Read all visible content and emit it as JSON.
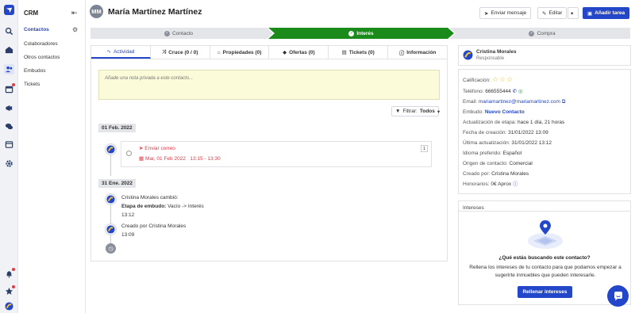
{
  "colors": {
    "brand": "#2446c9",
    "stage_done": "#e4e5e8",
    "stage_current": "#1a8a1a",
    "alert": "#e63946",
    "star": "#f2c230"
  },
  "sidebar": {
    "title": "CRM",
    "items": [
      {
        "label": "Contactos"
      },
      {
        "label": "Colaboradores"
      },
      {
        "label": "Otros contactos"
      },
      {
        "label": "Embudos"
      },
      {
        "label": "Tickets"
      }
    ]
  },
  "header": {
    "avatar_initials": "MM",
    "contact_name": "María Martínez Martínez",
    "send_message_label": "Enviar mensaje",
    "edit_label": "Editar",
    "add_task_label": "Añadir tarea"
  },
  "stages": [
    {
      "label": "Contacto"
    },
    {
      "label": "Interés"
    },
    {
      "label": "Compra"
    }
  ],
  "tabs": [
    {
      "label": "Actividad"
    },
    {
      "label": "Cruce (0 / 0)"
    },
    {
      "label": "Propiedades (0)"
    },
    {
      "label": "Ofertas (0)"
    },
    {
      "label": "Tickets (0)"
    },
    {
      "label": "Información"
    }
  ],
  "note_placeholder": "Añade una nota privada a este contacto...",
  "filter": {
    "prefix": "Filtrar:",
    "value": "Todos"
  },
  "timeline": {
    "date1": "01 Feb. 2022",
    "task": {
      "title": "Enviar correo",
      "date": "Mar, 01 Feb 2022",
      "time": "13:15 - 13:30",
      "count": "1"
    },
    "date2": "31 Ene. 2022",
    "event1": {
      "line1": "Cristina Morales cambió:",
      "field": "Etapa de embudo:",
      "change": "Vacío -> Interés",
      "time": "13:12"
    },
    "event2": {
      "line1": "Creado por Cristina Morales",
      "time": "13:09"
    }
  },
  "owner": {
    "name": "Cristina Morales",
    "role": "Responsable"
  },
  "details": {
    "rating_label": "Calificación:",
    "phone_label": "Teléfono:",
    "phone": "666555444",
    "email_label": "Email:",
    "email": "mariamartinez@mariamartinez.com",
    "funnel_label": "Embudo:",
    "funnel": "Nuevo Contacto",
    "stage_update_label": "Actualización de etapa:",
    "stage_update": "hace 1 día, 21 horas",
    "created_label": "Fecha de creación:",
    "created": "31/01/2022 13:09",
    "last_update_label": "Última actualización:",
    "last_update": "31/01/2022 13:12",
    "language_label": "Idioma preferido:",
    "language": "Español",
    "origin_label": "Origen de contacto:",
    "origin": "Comercial",
    "created_by_label": "Creado por:",
    "created_by": "Cristina Morales",
    "fees_label": "Honorarios:",
    "fees": "0€ Aprox"
  },
  "interests": {
    "title": "Intereses",
    "question": "¿Qué estás buscando este contacto?",
    "description": "Rellena los intereses de tu contacto para que podamos empezar a sugerirte inmuebles que pueden interesarle.",
    "button_label": "Rellenar intereses"
  }
}
